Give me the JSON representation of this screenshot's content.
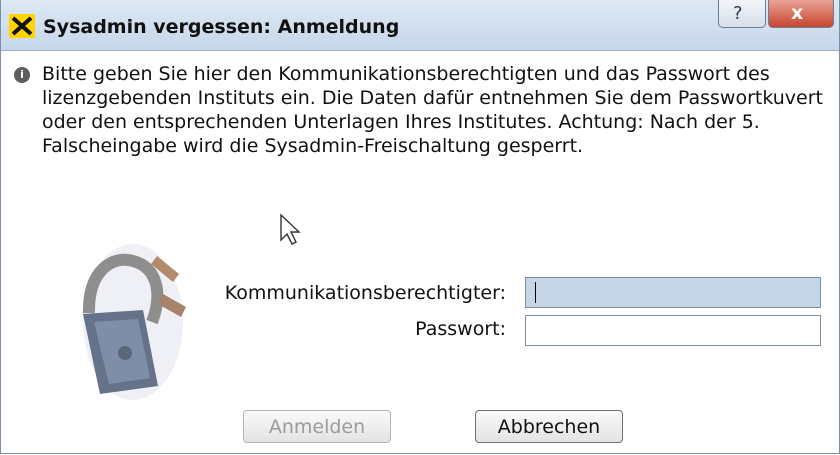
{
  "window": {
    "title": "Sysadmin vergessen: Anmeldung",
    "help_glyph": "?",
    "close_glyph": "x"
  },
  "message": {
    "icon": "info-icon",
    "text": "Bitte geben Sie hier den Kommunikationsberechtigten und das Passwort des lizenzgebenden Instituts ein. Die Daten dafür entnehmen Sie dem Passwortkuvert oder den entsprechenden Unterlagen Ihres Institutes. Achtung: Nach der 5. Falscheingabe wird die Sysadmin-Freischaltung gesperrt."
  },
  "form": {
    "communication_label": "Kommunikationsberechtigter:",
    "communication_value": "",
    "password_label": "Passwort:",
    "password_value": ""
  },
  "buttons": {
    "login": "Anmelden",
    "cancel": "Abbrechen"
  },
  "colors": {
    "titlebar": "#c6d7ea",
    "active_field": "#c7d6e6",
    "close_button": "#c8452f"
  }
}
